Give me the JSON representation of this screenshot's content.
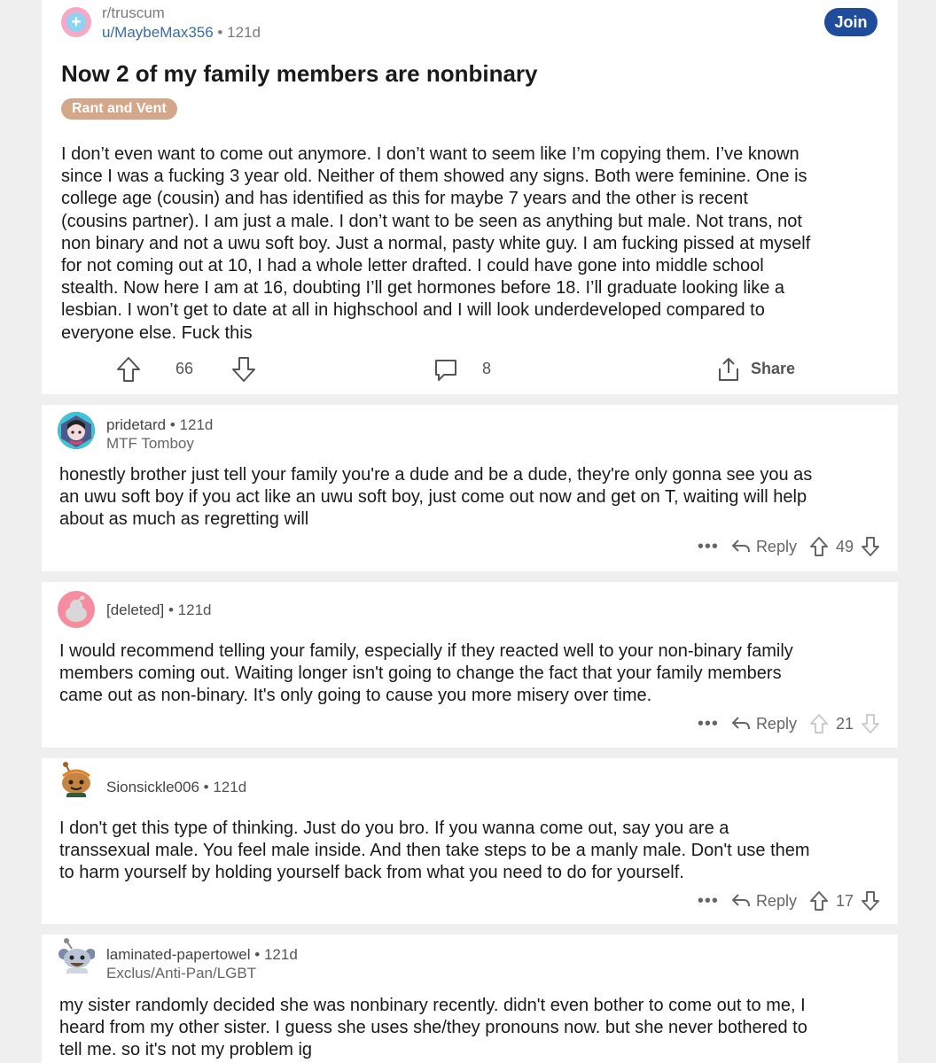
{
  "post": {
    "subreddit": "r/truscum",
    "author": "u/MaybeMax356",
    "age": "121d",
    "join_label": "Join",
    "title": "Now 2 of my family members are nonbinary",
    "flair": "Rant and Vent",
    "body_lines": [
      "I don’t even want to come out anymore. I don’t want to seem like I’m copying them. I’ve known",
      "since I was a fucking 3 year old. Neither of them showed any signs. Both were feminine. One is",
      "college age (cousin) and has identified as this for maybe 7 years and the other is recent",
      "(cousins partner). I am just a male. I don’t want to be seen as anything but male. Not trans, not",
      "non binary and not a uwu soft boy. Just a normal, pasty white guy. I am fucking pissed at myself",
      "for not coming out at 10, I had a whole letter drafted. I could have gone into middle school",
      "stealth. Now here I am at 16, doubting I’ll get hormones before 18. I’ll graduate looking like a",
      "lesbian. I won’t get to date at all in highschool and I will look underdeveloped compared to",
      "everyone else. Fuck this"
    ],
    "upvotes": "66",
    "comments": "8",
    "share_label": "Share"
  },
  "comments": [
    {
      "username": "pridetard",
      "age": "121d",
      "flair": "MTF Tomboy",
      "body_lines": [
        "honestly brother just tell your family you're a dude and be a dude, they're only gonna see you as",
        "an uwu soft boy if you act like an uwu soft boy, just come out now and get on T, waiting will help",
        "about as much as regretting will"
      ],
      "reply_label": "Reply",
      "score": "49"
    },
    {
      "username": "[deleted]",
      "age": "121d",
      "body_lines": [
        "I would recommend telling your family, especially if they reacted well to your non-binary family",
        "members coming out. Waiting longer isn't going to change the fact that your family members",
        "came out as non-binary. It's only going to cause you more misery over time."
      ],
      "reply_label": "Reply",
      "score": "21"
    },
    {
      "username": "Sionsickle006",
      "age": "121d",
      "body_lines": [
        "I don't get this type of thinking. Just do you bro. If you wanna come out, say you are a",
        "transsexual male. You feel male inside. And then take steps to be a manly male. Don't use them",
        "to harm yourself by holding yourself back from what you need to do for yourself."
      ],
      "reply_label": "Reply",
      "score": "17"
    },
    {
      "username": "laminated-papertowel",
      "age": "121d",
      "flair": "Exclus/Anti-Pan/LGBT",
      "body_lines": [
        "my sister randomly decided she was nonbinary recently. didn't even bother to come out to me, I",
        "heard from my other sister. I guess she uses she/they pronouns now. but she never bothered to",
        "tell me. so it's not my problem ig"
      ]
    }
  ],
  "separator": "•",
  "more_dots": "•••"
}
